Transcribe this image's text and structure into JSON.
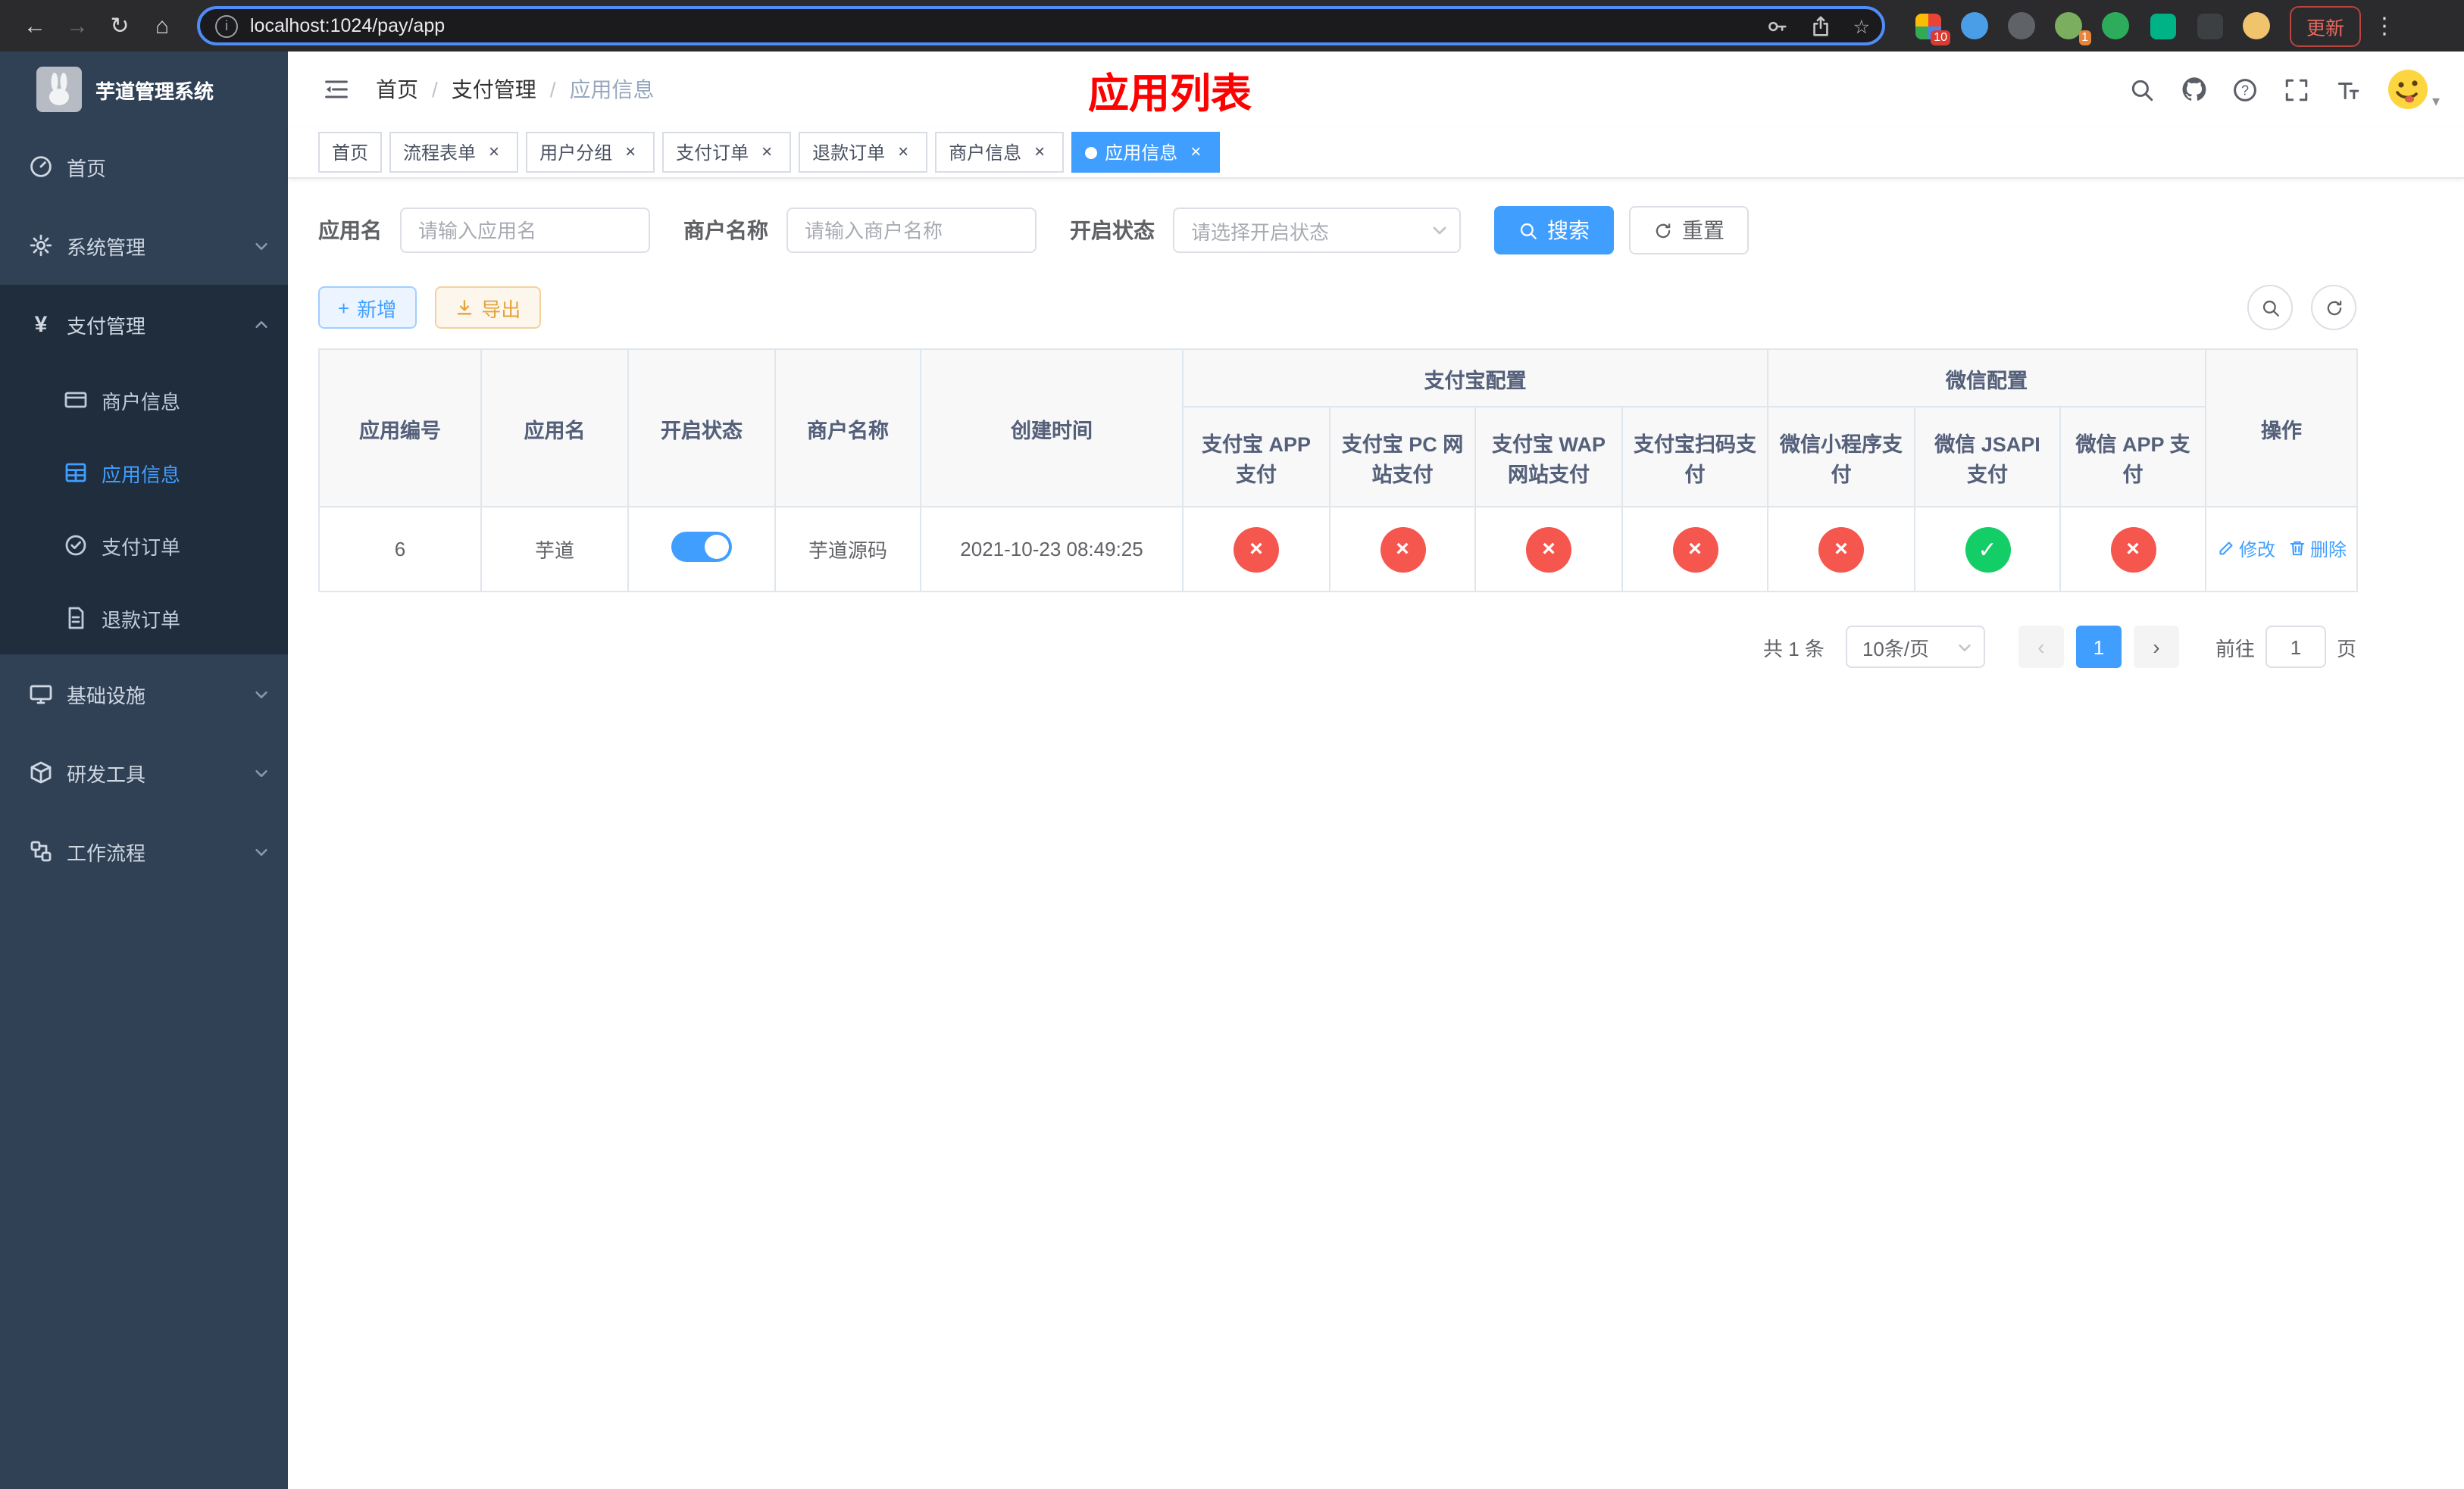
{
  "icons": {
    "back": "←",
    "forward": "→",
    "reload": "↻",
    "home": "⌂",
    "info": "i",
    "star": "☆",
    "menu_dots": "⋮",
    "close": "×",
    "sep": "/",
    "cross": "×",
    "check": "✓",
    "prev": "‹",
    "next": "›",
    "plus": "+",
    "caret": "▾",
    "yen": "¥"
  },
  "browser": {
    "url": "localhost:1024/pay/app",
    "update_label": "更新",
    "extensions": [
      {
        "name": "extensions-grid",
        "badge": "10"
      },
      {
        "name": "blue-drop"
      },
      {
        "name": "dark-circle"
      },
      {
        "name": "profile-circle",
        "badge": "1"
      },
      {
        "name": "green-circle"
      },
      {
        "name": "green-square"
      },
      {
        "name": "dark-square"
      },
      {
        "name": "face-circle"
      }
    ]
  },
  "sidebar": {
    "title": "芋道管理系统",
    "items": [
      {
        "label": "首页"
      },
      {
        "label": "系统管理"
      },
      {
        "label": "支付管理",
        "expanded": true,
        "children": [
          {
            "label": "商户信息"
          },
          {
            "label": "应用信息",
            "active": true
          },
          {
            "label": "支付订单"
          },
          {
            "label": "退款订单"
          }
        ]
      },
      {
        "label": "基础设施"
      },
      {
        "label": "研发工具"
      },
      {
        "label": "工作流程"
      }
    ]
  },
  "header": {
    "breadcrumb": [
      "首页",
      "支付管理",
      "应用信息"
    ],
    "title": "应用列表"
  },
  "tabs": [
    {
      "label": "首页",
      "closable": false,
      "active": false
    },
    {
      "label": "流程表单",
      "closable": true,
      "active": false
    },
    {
      "label": "用户分组",
      "closable": true,
      "active": false
    },
    {
      "label": "支付订单",
      "closable": true,
      "active": false
    },
    {
      "label": "退款订单",
      "closable": true,
      "active": false
    },
    {
      "label": "商户信息",
      "closable": true,
      "active": false
    },
    {
      "label": "应用信息",
      "closable": true,
      "active": true
    }
  ],
  "filters": {
    "app_name_label": "应用名",
    "app_name_placeholder": "请输入应用名",
    "merchant_label": "商户名称",
    "merchant_placeholder": "请输入商户名称",
    "status_label": "开启状态",
    "status_placeholder": "请选择开启状态",
    "search_label": "搜索",
    "reset_label": "重置"
  },
  "toolbar": {
    "add_label": "新增",
    "export_label": "导出"
  },
  "table": {
    "group_alipay": "支付宝配置",
    "group_wechat": "微信配置",
    "columns": [
      "应用编号",
      "应用名",
      "开启状态",
      "商户名称",
      "创建时间",
      "支付宝 APP 支付",
      "支付宝 PC 网站支付",
      "支付宝 WAP 网站支付",
      "支付宝扫码支付",
      "微信小程序支付",
      "微信 JSAPI 支付",
      "微信 APP 支付",
      "操作"
    ],
    "row": {
      "id": "6",
      "name": "芋道",
      "enabled": true,
      "merchant": "芋道源码",
      "created": "2021-10-23 08:49:25",
      "alipay_app": false,
      "alipay_pc": false,
      "alipay_wap": false,
      "alipay_qr": false,
      "wechat_lite": false,
      "wechat_jsapi": true,
      "wechat_app": false
    },
    "edit_label": "修改",
    "delete_label": "删除"
  },
  "pagination": {
    "total_text": "共 1 条",
    "page_size": "10条/页",
    "current_page": "1",
    "goto_label": "前往",
    "goto_value": "1",
    "unit_label": "页"
  }
}
